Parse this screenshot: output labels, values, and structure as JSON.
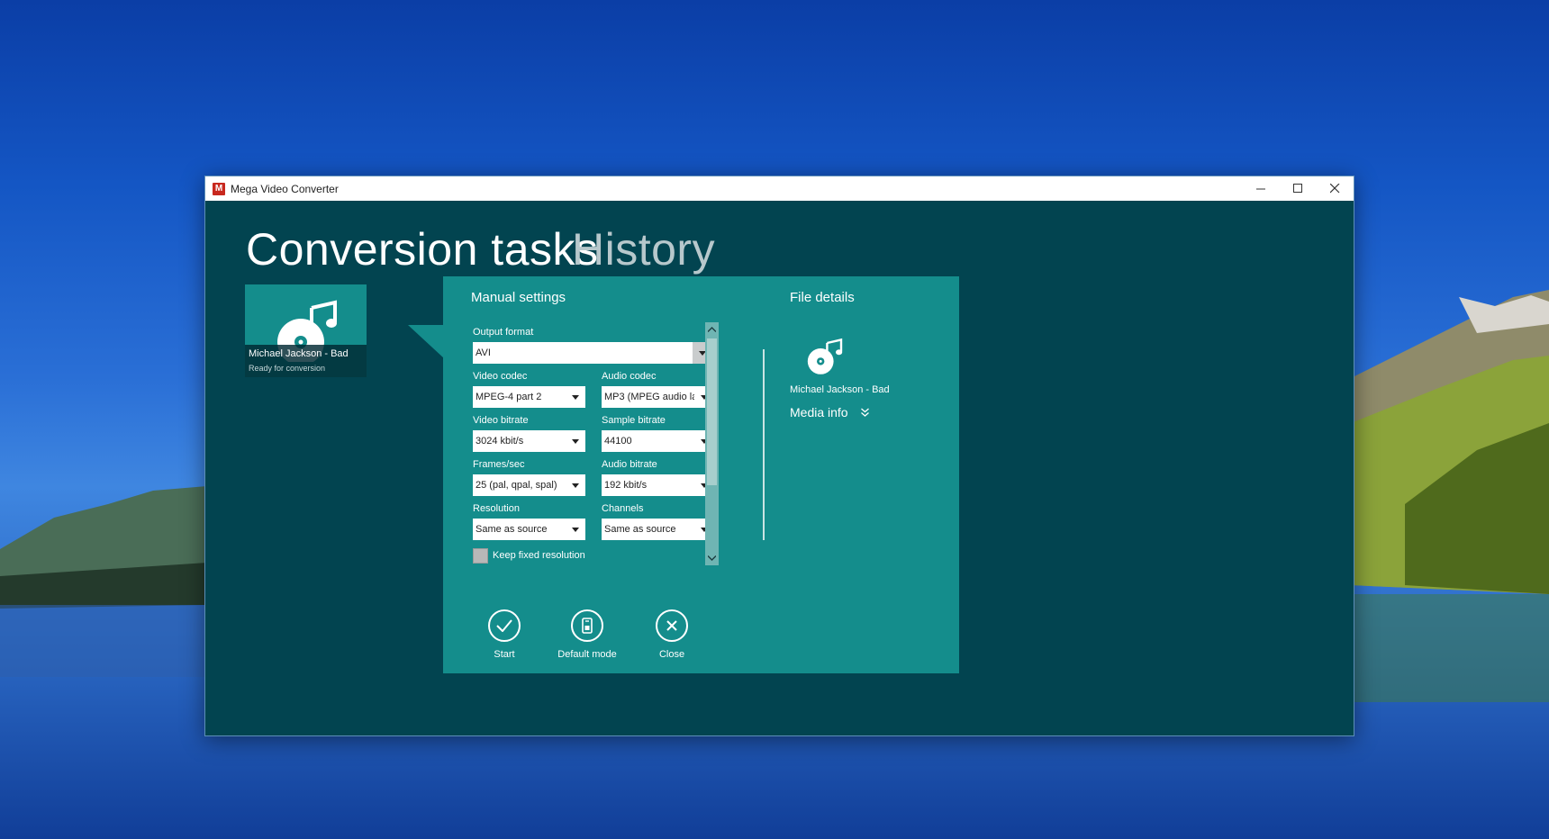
{
  "window": {
    "title": "Mega Video Converter",
    "logo_letter": "M"
  },
  "header": {
    "tab_active": "Conversion tasks",
    "tab_inactive": "History"
  },
  "task": {
    "name": "Michael Jackson - Bad",
    "status": "Ready for conversion"
  },
  "manual_settings": {
    "title": "Manual settings",
    "output_format": {
      "label": "Output format",
      "value": "AVI"
    },
    "video_codec": {
      "label": "Video codec",
      "value": "MPEG-4 part 2"
    },
    "audio_codec": {
      "label": "Audio codec",
      "value": "MP3 (MPEG audio lay"
    },
    "video_bitrate": {
      "label": "Video bitrate",
      "value": "3024 kbit/s"
    },
    "sample_bitrate": {
      "label": "Sample bitrate",
      "value": "44100"
    },
    "frames_sec": {
      "label": "Frames/sec",
      "value": "25 (pal, qpal, spal)"
    },
    "audio_bitrate": {
      "label": "Audio bitrate",
      "value": "192 kbit/s"
    },
    "resolution": {
      "label": "Resolution",
      "value": "Same as source"
    },
    "channels": {
      "label": "Channels",
      "value": "Same as source"
    },
    "keep_fixed_resolution": {
      "label": "Keep fixed resolution",
      "checked": false
    }
  },
  "file_details": {
    "title": "File details",
    "file_name": "Michael Jackson - Bad",
    "media_info_label": "Media info"
  },
  "actions": {
    "start": "Start",
    "default_mode": "Default mode",
    "close": "Close"
  },
  "colors": {
    "window_bg": "#024450",
    "panel_bg": "#148d8c",
    "accent_logo": "#c8281e"
  }
}
